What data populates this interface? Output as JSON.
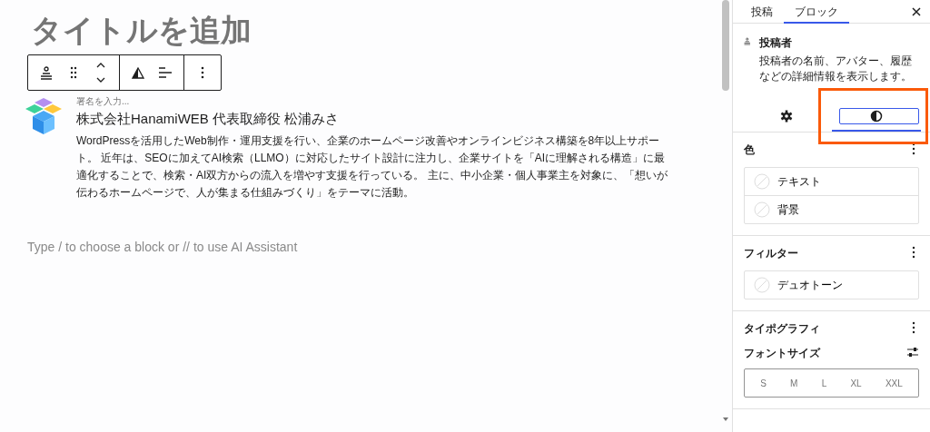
{
  "editor": {
    "title_placeholder": "タイトルを追加",
    "author_block": {
      "byline_placeholder": "署名を入力...",
      "name": "株式会社HanamiWEB 代表取締役 松浦みさ",
      "bio": "WordPressを活用したWeb制作・運用支援を行い、企業のホームページ改善やオンラインビジネス構築を8年以上サポート。 近年は、SEOに加えてAI検索（LLMO）に対応したサイト設計に注力し、企業サイトを「AIに理解される構造」に最適化することで、検索・AI双方からの流入を増やす支援を行っている。 主に、中小企業・個人事業主を対象に、「想いが伝わるホームページで、人が集まる仕組みづくり」をテーマに活動。"
    },
    "block_placeholder": "Type / to choose a block or // to use AI Assistant"
  },
  "sidebar": {
    "tabs": [
      {
        "label": "投稿",
        "selected": false
      },
      {
        "label": "ブロック",
        "selected": true
      }
    ],
    "block_card": {
      "title": "投稿者",
      "description": "投稿者の名前、アバター、履歴などの詳細情報を表示します。"
    },
    "sub_tabs": [
      {
        "kind": "settings",
        "selected": false
      },
      {
        "kind": "styles",
        "selected": true
      }
    ],
    "panels": [
      {
        "kind": "items",
        "title": "色",
        "items": [
          "テキスト",
          "背景"
        ]
      },
      {
        "kind": "items",
        "title": "フィルター",
        "items": [
          "デュオトーン"
        ]
      },
      {
        "kind": "typography",
        "title": "タイポグラフィ",
        "label": "フォントサイズ",
        "sizes": [
          "S",
          "M",
          "L",
          "XL",
          "XXL"
        ]
      }
    ]
  }
}
